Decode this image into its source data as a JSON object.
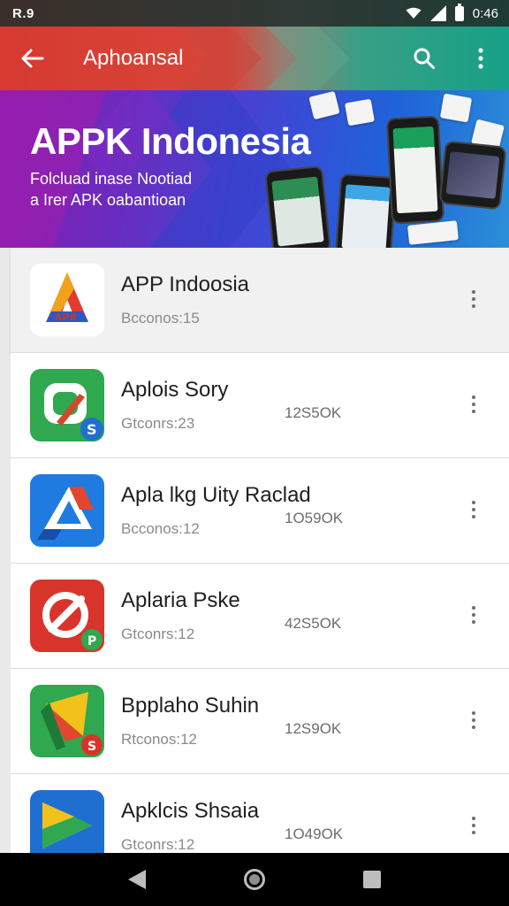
{
  "status_bar": {
    "left_text": "R.9",
    "time": "0:46",
    "icons": [
      "wifi-icon",
      "signal-icon",
      "battery-icon"
    ]
  },
  "app_bar": {
    "title": "Aphoansal",
    "icons": [
      "back-arrow-icon",
      "search-icon",
      "more-vert-icon"
    ],
    "colors": {
      "left": "#d63a31",
      "right": "#16a086"
    }
  },
  "banner": {
    "title": "APPK Indonesia",
    "subtitle_line1": "Folcluad inase Nootiad",
    "subtitle_line2": "a Irer APK oabantioan"
  },
  "apps": [
    {
      "name": "APP Indoosia",
      "sub": "Bcconos:15",
      "size": "",
      "icon": "app-indoosia-icon"
    },
    {
      "name": "Aplois Sory",
      "sub": "Gtconrs:23",
      "size": "12S5OK",
      "icon": "aplois-sory-icon"
    },
    {
      "name": "Apla lkg Uity Raclad",
      "sub": "Bcconos:12",
      "size": "1O59OK",
      "icon": "apla-lkg-icon"
    },
    {
      "name": "Aplaria Pske",
      "sub": "Gtconrs:12",
      "size": "42S5OK",
      "icon": "aplaria-pske-icon"
    },
    {
      "name": "Bpplaho Suhin",
      "sub": "Rtconos:12",
      "size": "12S9OK",
      "icon": "bpplaho-suhin-icon"
    },
    {
      "name": "Apklcis Shsaia",
      "sub": "Gtconrs:12",
      "size": "1O49OK",
      "icon": "apklcis-shsaia-icon"
    }
  ],
  "nav_bar": {
    "icons": [
      "nav-back-icon",
      "nav-home-icon",
      "nav-recents-icon"
    ]
  }
}
